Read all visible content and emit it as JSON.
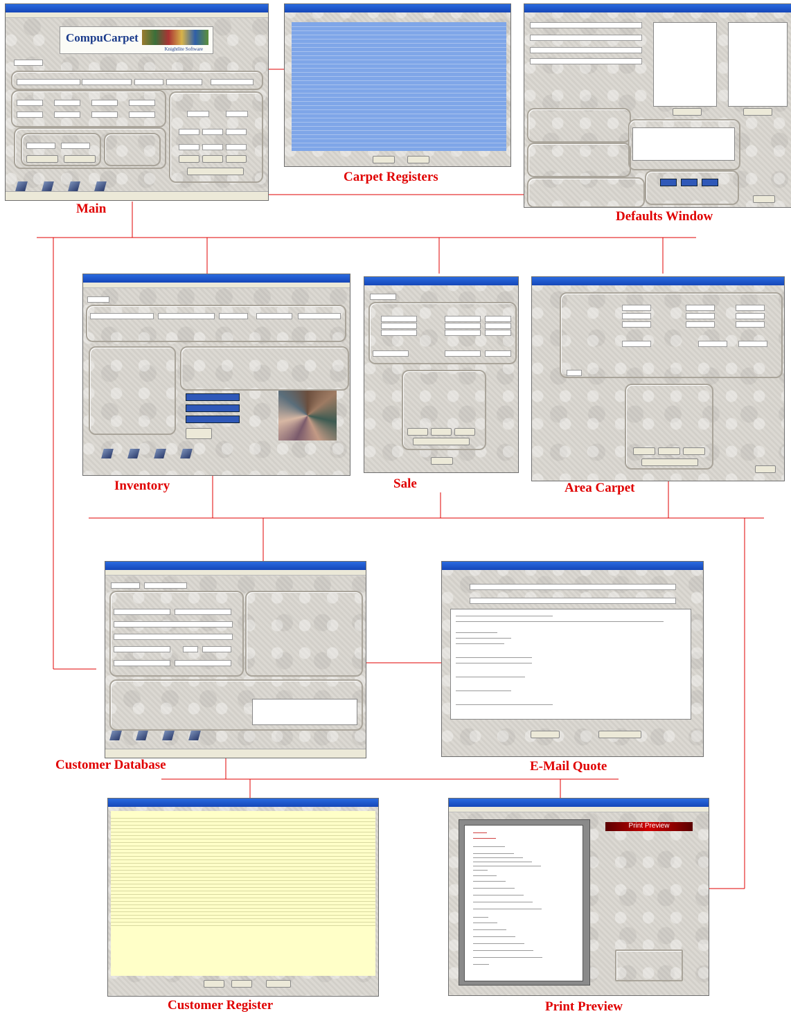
{
  "nodes": {
    "main": {
      "caption": "Main",
      "logo_text": "CompuCarpet",
      "logo_sub": "Knightlite Software"
    },
    "carpet_registers": {
      "caption": "Carpet Registers"
    },
    "defaults_window": {
      "caption": "Defaults Window"
    },
    "inventory": {
      "caption": "Inventory"
    },
    "sale": {
      "caption": "Sale"
    },
    "area_carpet": {
      "caption": "Area Carpet"
    },
    "customer_database": {
      "caption": "Customer Database"
    },
    "email_quote": {
      "caption": "E-Mail Quote"
    },
    "customer_register": {
      "caption": "Customer Register"
    },
    "print_preview": {
      "caption": "Print Preview",
      "banner": "Print Preview"
    }
  },
  "colors": {
    "connector": "#e00000",
    "caption": "#e00000",
    "titlebar": "#1546b8",
    "register_list": "#7fa6e8",
    "customer_list": "#ffffc8"
  }
}
